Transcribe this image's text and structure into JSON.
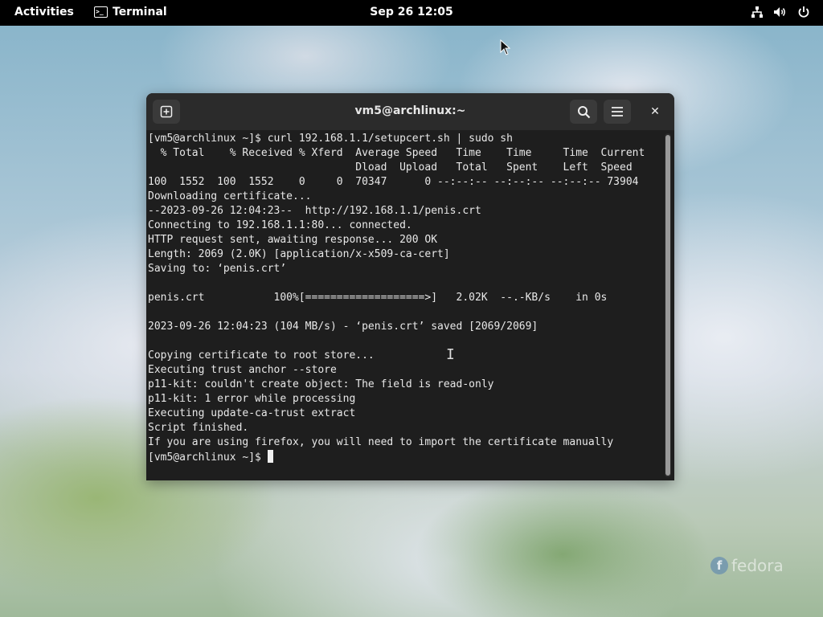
{
  "topbar": {
    "activities_label": "Activities",
    "app_name": "Terminal",
    "app_icon_glyph": ">_",
    "clock": "Sep 26  12:05",
    "status_icons": [
      "network-icon",
      "volume-icon",
      "power-icon"
    ]
  },
  "window": {
    "title": "vm5@archlinux:~",
    "close_glyph": "✕"
  },
  "terminal": {
    "lines": [
      "[vm5@archlinux ~]$ curl 192.168.1.1/setupcert.sh | sudo sh",
      "  % Total    % Received % Xferd  Average Speed   Time    Time     Time  Current",
      "                                 Dload  Upload   Total   Spent    Left  Speed",
      "100  1552  100  1552    0     0  70347      0 --:--:-- --:--:-- --:--:-- 73904",
      "Downloading certificate...",
      "--2023-09-26 12:04:23--  http://192.168.1.1/penis.crt",
      "Connecting to 192.168.1.1:80... connected.",
      "HTTP request sent, awaiting response... 200 OK",
      "Length: 2069 (2.0K) [application/x-x509-ca-cert]",
      "Saving to: ‘penis.crt’",
      "",
      "penis.crt           100%[===================>]   2.02K  --.-KB/s    in 0s",
      "",
      "2023-09-26 12:04:23 (104 MB/s) - ‘penis.crt’ saved [2069/2069]",
      "",
      "Copying certificate to root store...",
      "Executing trust anchor --store",
      "p11-kit: couldn't create object: The field is read-only",
      "p11-kit: 1 error while processing",
      "Executing update-ca-trust extract",
      "Script finished.",
      "If you are using firefox, you will need to import the certificate manually"
    ],
    "prompt": "[vm5@archlinux ~]$ "
  },
  "watermark": {
    "logo_glyph": "f",
    "text": "fedora"
  }
}
